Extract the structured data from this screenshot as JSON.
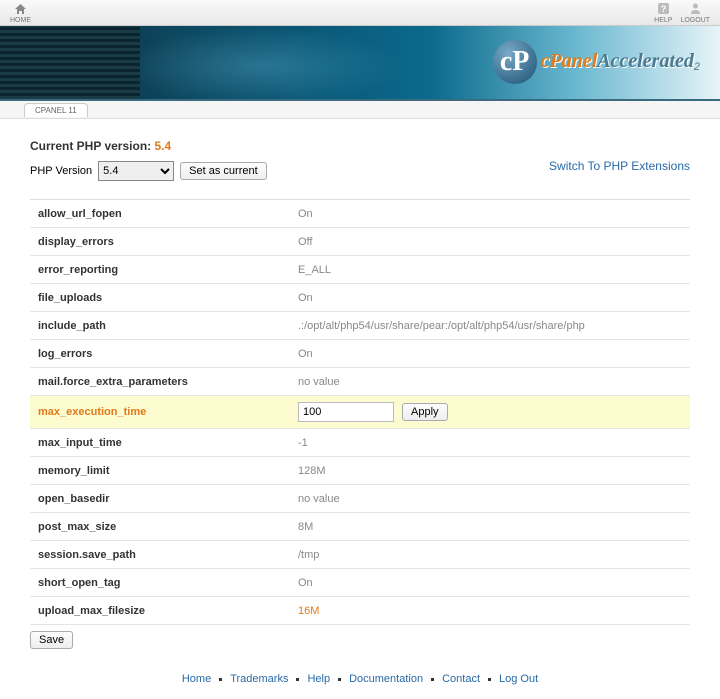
{
  "topbar": {
    "home": "HOME",
    "help": "HELP",
    "logout": "LOGOUT"
  },
  "banner": {
    "brand1": "cPanel",
    "brand2": "Accelerated",
    "sub": "2"
  },
  "tab": "CPANEL 11",
  "header": {
    "cur_label": "Current PHP version:",
    "cur_value": "5.4",
    "ver_label": "PHP Version",
    "ver_selected": "5.4",
    "set_btn": "Set as current",
    "ext_link": "Switch To PHP Extensions"
  },
  "options": [
    {
      "name": "allow_url_fopen",
      "value": "On"
    },
    {
      "name": "display_errors",
      "value": "Off"
    },
    {
      "name": "error_reporting",
      "value": "E_ALL"
    },
    {
      "name": "file_uploads",
      "value": "On"
    },
    {
      "name": "include_path",
      "value": ".:/opt/alt/php54/usr/share/pear:/opt/alt/php54/usr/share/php"
    },
    {
      "name": "log_errors",
      "value": "On"
    },
    {
      "name": "mail.force_extra_parameters",
      "value": "no value"
    },
    {
      "name": "max_execution_time",
      "value": "100",
      "editing": true,
      "apply": "Apply"
    },
    {
      "name": "max_input_time",
      "value": "-1"
    },
    {
      "name": "memory_limit",
      "value": "128M"
    },
    {
      "name": "open_basedir",
      "value": "no value"
    },
    {
      "name": "post_max_size",
      "value": "8M"
    },
    {
      "name": "session.save_path",
      "value": "/tmp"
    },
    {
      "name": "short_open_tag",
      "value": "On"
    },
    {
      "name": "upload_max_filesize",
      "value": "16M",
      "orange": true
    }
  ],
  "save_btn": "Save",
  "footer": {
    "links": [
      "Home",
      "Trademarks",
      "Help",
      "Documentation",
      "Contact",
      "Log Out"
    ]
  }
}
